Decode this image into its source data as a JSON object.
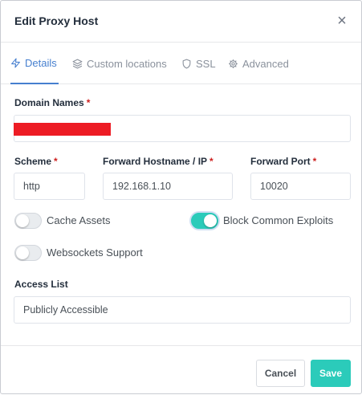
{
  "modal": {
    "title": "Edit Proxy Host",
    "close_symbol": "×"
  },
  "tabs": [
    {
      "label": "Details",
      "icon": "bolt-icon",
      "active": true
    },
    {
      "label": "Custom locations",
      "icon": "layers-icon",
      "active": false
    },
    {
      "label": "SSL",
      "icon": "shield-icon",
      "active": false
    },
    {
      "label": "Advanced",
      "icon": "gear-icon",
      "active": false
    }
  ],
  "form": {
    "domain_names": {
      "label": "Domain Names",
      "required_mark": "*",
      "value": "",
      "redacted": true
    },
    "scheme": {
      "label": "Scheme",
      "required_mark": "*",
      "value": "http"
    },
    "forward_hostname": {
      "label": "Forward Hostname / IP",
      "required_mark": "*",
      "value": "192.168.1.10"
    },
    "forward_port": {
      "label": "Forward Port",
      "required_mark": "*",
      "value": "10020"
    },
    "cache_assets": {
      "label": "Cache Assets",
      "enabled": false
    },
    "block_common_exploits": {
      "label": "Block Common Exploits",
      "enabled": true
    },
    "websockets_support": {
      "label": "Websockets Support",
      "enabled": false
    },
    "access_list": {
      "label": "Access List",
      "value": "Publicly Accessible"
    }
  },
  "footer": {
    "cancel_label": "Cancel",
    "save_label": "Save"
  },
  "colors": {
    "accent": "#467fcf",
    "teal": "#2bcbba",
    "required": "#cd201f",
    "redaction": "#ed1c24"
  }
}
